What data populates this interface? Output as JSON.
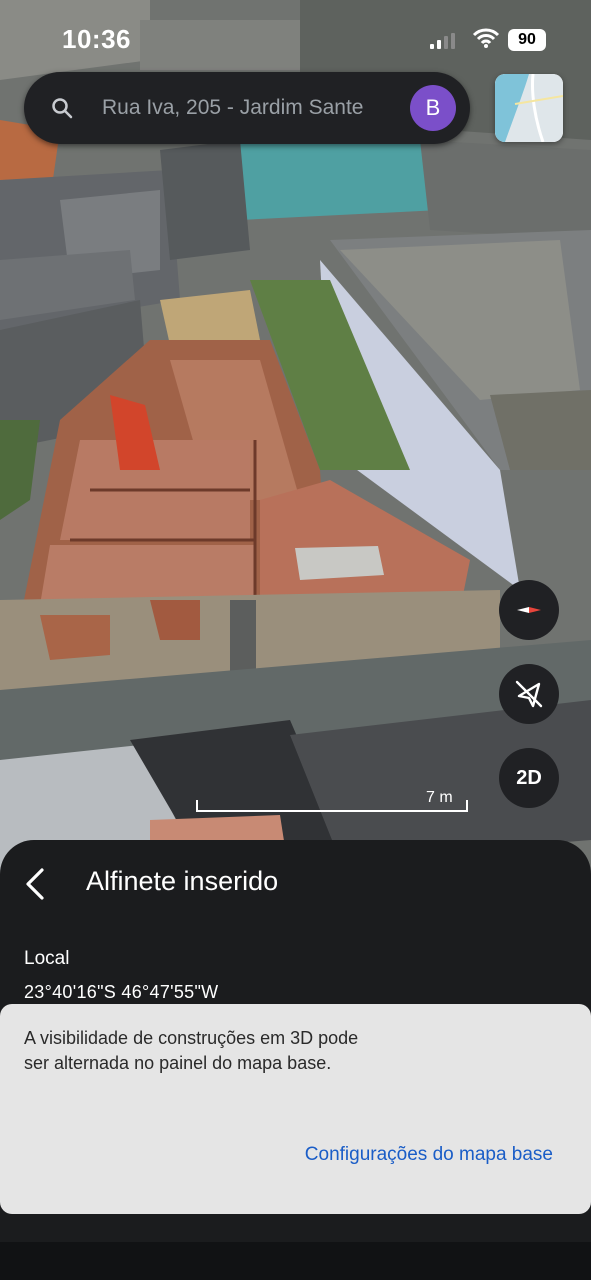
{
  "status_bar": {
    "time": "10:36",
    "battery": "90"
  },
  "search": {
    "text": "Rua Iva, 205 - Jardim Sante",
    "avatar_letter": "B"
  },
  "map": {
    "scale_label": "7 m",
    "buttons": {
      "compass": "compass-icon",
      "tilt": "tilt-off-icon",
      "view_mode": "2D"
    }
  },
  "sheet": {
    "title": "Alfinete inserido",
    "local_label": "Local",
    "coordinates": "23°40'16\"S 46°47'55\"W"
  },
  "snackbar": {
    "message": "A visibilidade de construções em 3D pode ser alternada no painel do mapa base.",
    "action": "Configurações do mapa base"
  },
  "colors": {
    "accent": "#1a5dc7",
    "avatar": "#7b4fc9",
    "sheet_bg": "#1b1c1e",
    "snackbar_bg": "#e5e5e5"
  }
}
